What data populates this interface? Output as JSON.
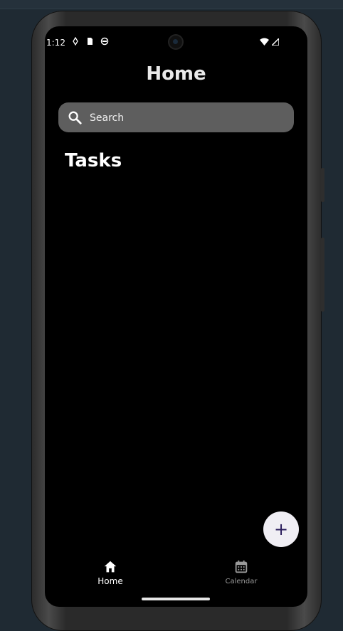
{
  "status_bar": {
    "time": "1:12",
    "icons_left": [
      "location-icon",
      "sd-card-icon",
      "sync-icon"
    ],
    "icons_right": [
      "wifi-icon",
      "signal-icon"
    ]
  },
  "header": {
    "title": "Home"
  },
  "search": {
    "placeholder": "Search",
    "value": ""
  },
  "tasks_section": {
    "title": "Tasks"
  },
  "fab": {
    "label": "+"
  },
  "bottom_nav": {
    "items": [
      {
        "label": "Home",
        "icon": "home-icon",
        "selected": true
      },
      {
        "label": "Calendar",
        "icon": "calendar-icon",
        "selected": false
      }
    ]
  },
  "colors": {
    "background": "#000000",
    "search_bg": "#5e5e5e",
    "fab_bg": "#f0eef4",
    "fab_fg": "#2a1c5c",
    "nav_selected": "#ffffff",
    "nav_unselected": "#9a9a9a"
  }
}
